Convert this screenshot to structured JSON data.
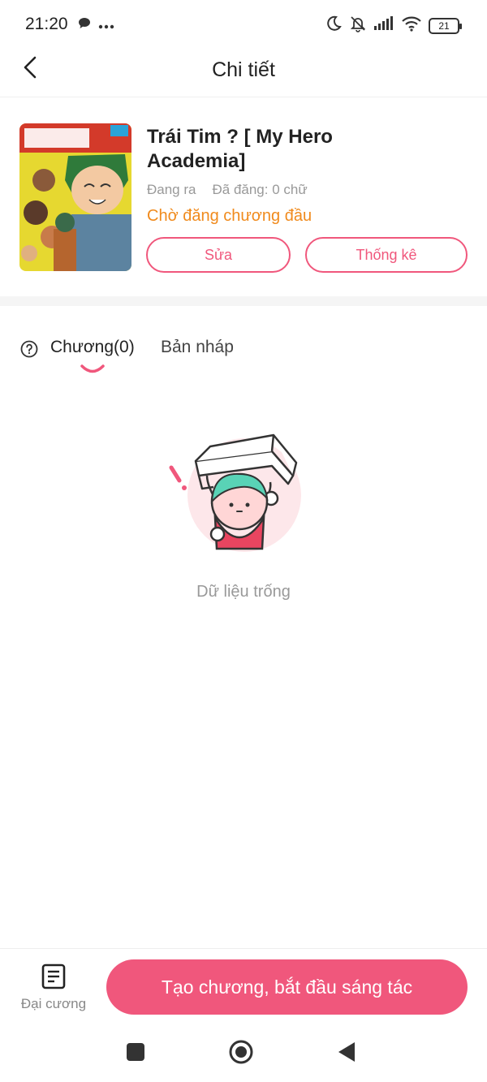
{
  "status_bar": {
    "time": "21:20",
    "battery_level": "21",
    "icons": [
      "chat-bubble-icon",
      "more-dots-icon",
      "moon-icon",
      "bell-off-icon",
      "signal-icon",
      "wifi-icon",
      "battery-icon"
    ]
  },
  "header": {
    "title": "Chi tiết",
    "back_icon": "chevron-left-icon"
  },
  "book": {
    "title": "Trái Tim ? [ My Hero Academia]",
    "status": "Đang ra",
    "published": "Đã đăng: 0 chữ",
    "pending_text": "Chờ đăng chương đầu",
    "edit_label": "Sửa",
    "stats_label": "Thống kê"
  },
  "tabs": {
    "chapters_label": "Chương(0)",
    "drafts_label": "Bản nháp",
    "active": "chapters"
  },
  "empty_state": {
    "text": "Dữ liệu trống"
  },
  "bottom_bar": {
    "outline_label": "Đại cương",
    "create_label": "Tạo chương, bắt đầu sáng tác"
  },
  "colors": {
    "accent": "#f0577c",
    "pending": "#f08a1c",
    "muted": "#999999"
  }
}
